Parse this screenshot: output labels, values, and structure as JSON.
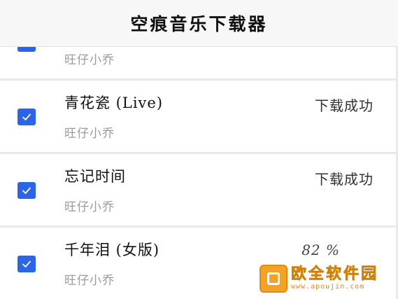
{
  "header": {
    "title": "空痕音乐下载器"
  },
  "songs": [
    {
      "title": "",
      "artist": "旺仔小乔",
      "status": "",
      "checked": true
    },
    {
      "title": "青花瓷 (Live)",
      "artist": "旺仔小乔",
      "status": "下载成功",
      "checked": true
    },
    {
      "title": "忘记时间",
      "artist": "旺仔小乔",
      "status": "下载成功",
      "checked": true
    },
    {
      "title": "千年泪 (女版)",
      "artist": "旺仔小乔",
      "status": "82 %",
      "checked": true
    }
  ],
  "watermark": {
    "name": "欧全软件园",
    "url": "www.apoujin.com"
  },
  "colors": {
    "checkbox": "#2b64e6",
    "watermark": "#f2a324"
  }
}
